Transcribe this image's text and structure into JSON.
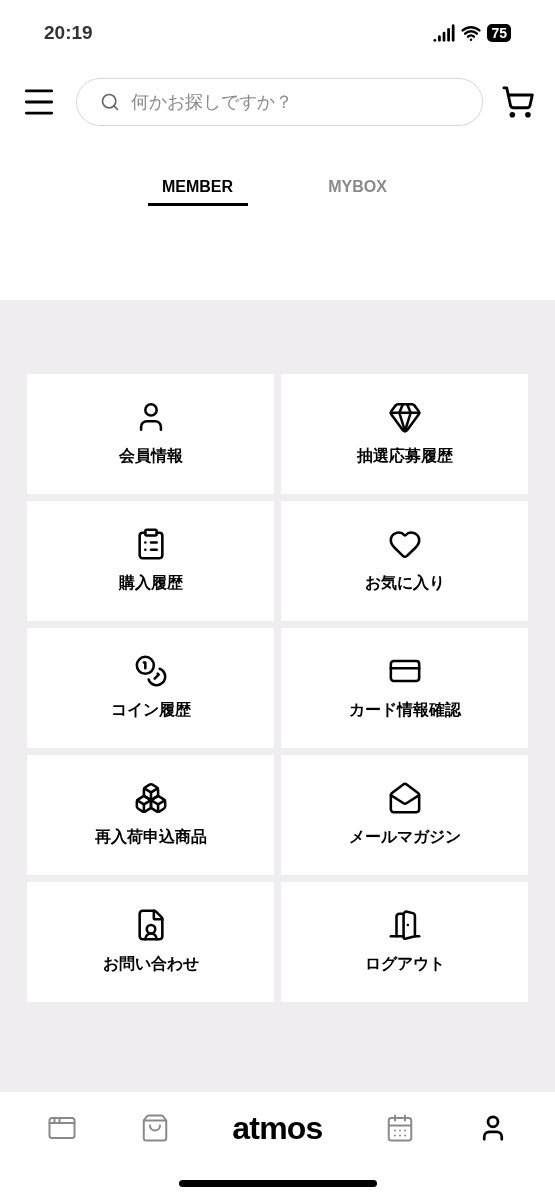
{
  "status_bar": {
    "time": "20:19",
    "battery": "75"
  },
  "search": {
    "placeholder": "何かお探しですか？"
  },
  "tabs": [
    {
      "label": "MEMBER",
      "selected": true
    },
    {
      "label": "MYBOX",
      "selected": false
    }
  ],
  "menu": [
    {
      "label": "会員情報"
    },
    {
      "label": "抽選応募履歴"
    },
    {
      "label": "購入履歴"
    },
    {
      "label": "お気に入り"
    },
    {
      "label": "コイン履歴"
    },
    {
      "label": "カード情報確認"
    },
    {
      "label": "再入荷申込商品"
    },
    {
      "label": "メールマガジン"
    },
    {
      "label": "お問い合わせ"
    },
    {
      "label": "ログアウト"
    }
  ],
  "bottom_nav": {
    "logo": "atmos",
    "items": [
      {
        "selected": false
      },
      {
        "selected": false
      },
      {
        "selected": false
      },
      {
        "selected": true
      }
    ]
  }
}
